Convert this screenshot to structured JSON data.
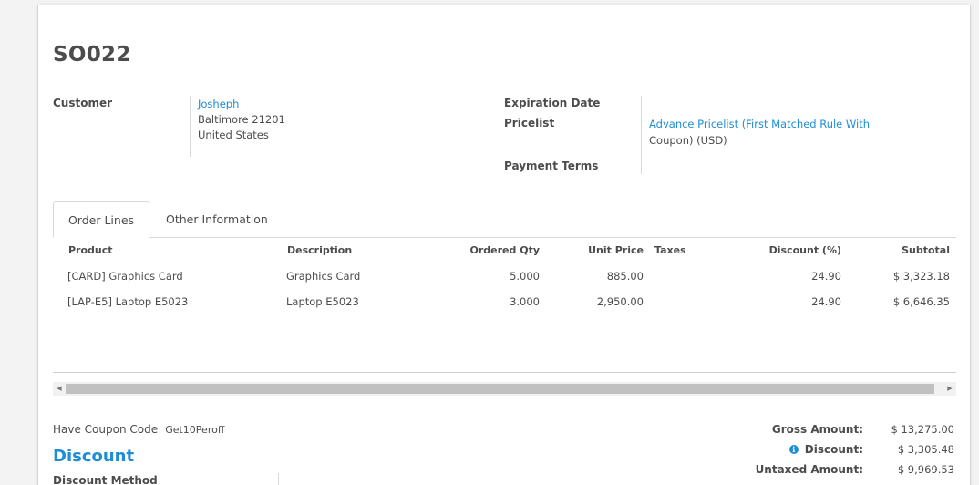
{
  "record": {
    "title": "SO022"
  },
  "customer": {
    "label": "Customer",
    "name": "Josheph",
    "address_line1": "Baltimore 21201",
    "address_line2": "United States"
  },
  "right_fields": {
    "expiration_label": "Expiration Date",
    "pricelist_label": "Pricelist",
    "pricelist_value_line1": "Advance Pricelist (First Matched Rule With",
    "pricelist_value_line2": "Coupon) (USD)",
    "payment_terms_label": "Payment Terms"
  },
  "tabs": [
    {
      "label": "Order Lines",
      "active": true
    },
    {
      "label": "Other Information",
      "active": false
    }
  ],
  "order_table": {
    "headers": {
      "product": "Product",
      "description": "Description",
      "ordered_qty": "Ordered Qty",
      "unit_price": "Unit Price",
      "taxes": "Taxes",
      "discount": "Discount (%)",
      "subtotal": "Subtotal"
    },
    "rows": [
      {
        "product": "[CARD] Graphics Card",
        "description": "Graphics Card",
        "ordered_qty": "5.000",
        "unit_price": "885.00",
        "taxes": "",
        "discount": "24.90",
        "subtotal": "$ 3,323.18"
      },
      {
        "product": "[LAP-E5] Laptop E5023",
        "description": "Laptop E5023",
        "ordered_qty": "3.000",
        "unit_price": "2,950.00",
        "taxes": "",
        "discount": "24.90",
        "subtotal": "$ 6,646.35"
      }
    ]
  },
  "coupon": {
    "label": "Have Coupon Code",
    "value": "Get10Peroff"
  },
  "discount_section": {
    "heading": "Discount",
    "method_label": "Discount Method"
  },
  "totals": {
    "gross_label": "Gross Amount:",
    "gross_value": "$ 13,275.00",
    "discount_label": "Discount:",
    "discount_value": "$ 3,305.48",
    "untaxed_label": "Untaxed Amount:",
    "untaxed_value": "$ 9,969.53"
  },
  "icons": {
    "info": "info-icon",
    "scroll_left": "arrow-left-icon",
    "scroll_right": "arrow-right-icon"
  },
  "colors": {
    "link": "#1f8dd6",
    "text": "#4c4c4c",
    "background": "#f3f3f3"
  }
}
